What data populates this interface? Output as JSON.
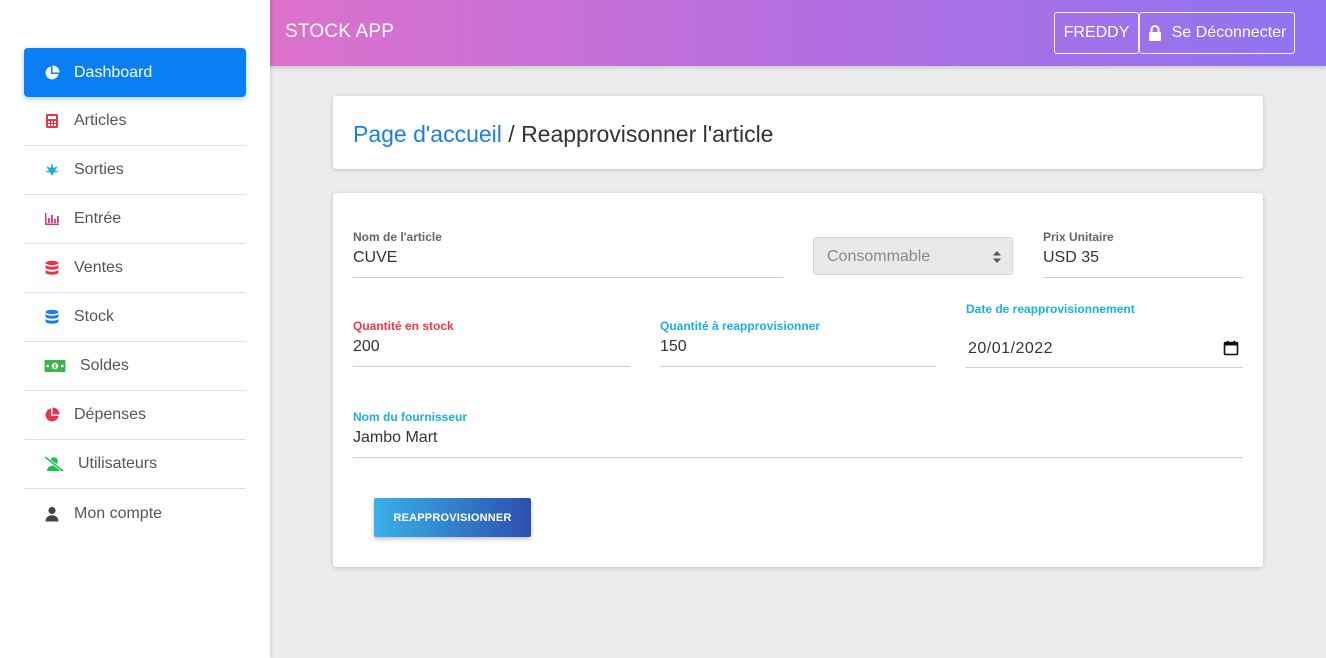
{
  "sidebar": {
    "items": [
      {
        "label": "Dashboard",
        "icon": "pie-chart-icon",
        "active": true,
        "color": "#ffffff"
      },
      {
        "label": "Articles",
        "icon": "calculator-icon",
        "color": "#e8334a"
      },
      {
        "label": "Sorties",
        "icon": "leaf-icon",
        "color": "#1ab0e0"
      },
      {
        "label": "Entrée",
        "icon": "bar-chart-icon",
        "color": "#d6338a"
      },
      {
        "label": "Ventes",
        "icon": "database-icon",
        "color": "#e8334a"
      },
      {
        "label": "Stock",
        "icon": "database-icon",
        "color": "#1a7fe3"
      },
      {
        "label": "Soldes",
        "icon": "money-icon",
        "color": "#3bb54a"
      },
      {
        "label": "Dépenses",
        "icon": "pie-chart-icon",
        "color": "#e8334a"
      },
      {
        "label": "Utilisateurs",
        "icon": "user-slash-icon",
        "color": "#1bc04f"
      },
      {
        "label": "Mon compte",
        "icon": "user-icon",
        "color": "#444444"
      }
    ]
  },
  "header": {
    "title": "STOCK APP",
    "user_label": "FREDDY",
    "logout_label": "Se Déconnecter",
    "logout_icon": "lock-icon"
  },
  "breadcrumb": {
    "home": "Page d'accueil",
    "separator": " / ",
    "current": "Reapprovisonner l'article"
  },
  "form": {
    "article_name": {
      "label": "Nom de l'article",
      "value": "CUVE"
    },
    "category": {
      "value": "Consommable"
    },
    "unit_price": {
      "label": "Prix Unitaire",
      "value": "USD 35"
    },
    "stock_qty": {
      "label": "Quantité en stock",
      "value": "200"
    },
    "restock_qty": {
      "label": "Quantité à reapprovisionner",
      "value": "150"
    },
    "restock_date": {
      "label": "Date de reapprovisionnement",
      "value": "20/01/2022"
    },
    "supplier": {
      "label": "Nom du fournisseur",
      "value": "Jambo Mart"
    },
    "submit_label": "REAPPROVISIONNER"
  },
  "colors": {
    "accent": "#0a7ff5",
    "link": "#1a7fe3",
    "label_red": "#f0354a",
    "label_blue": "#1ab0e0",
    "header_gradient_start": "#dd72cc",
    "header_gradient_end": "#8f73f2"
  }
}
